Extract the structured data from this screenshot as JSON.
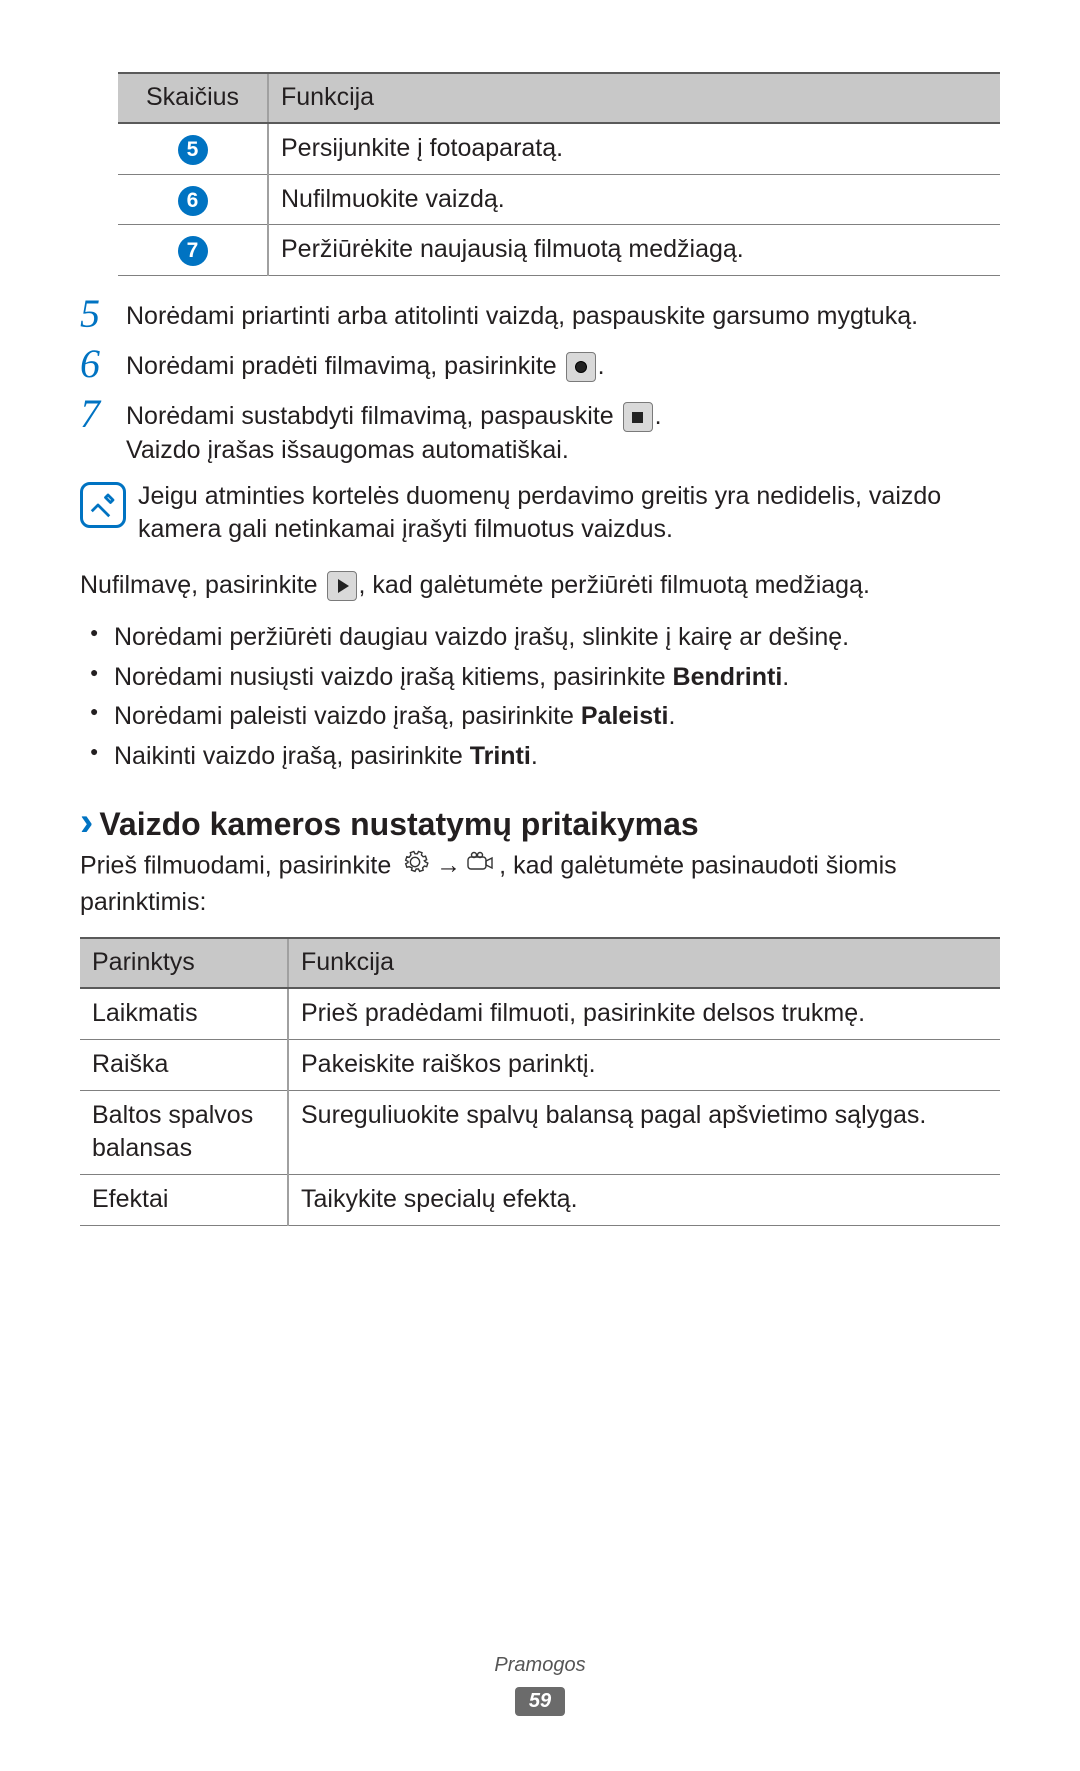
{
  "table1": {
    "headers": [
      "Skaičius",
      "Funkcija"
    ],
    "rows": [
      {
        "num": "5",
        "func": "Persijunkite į fotoaparatą."
      },
      {
        "num": "6",
        "func": "Nufilmuokite vaizdą."
      },
      {
        "num": "7",
        "func": "Peržiūrėkite naujausią filmuotą medžiagą."
      }
    ]
  },
  "steps": {
    "s5": {
      "num": "5",
      "text": "Norėdami priartinti arba atitolinti vaizdą, paspauskite garsumo mygtuką."
    },
    "s6": {
      "num": "6",
      "text_before": "Norėdami pradėti filmavimą, pasirinkite ",
      "text_after": "."
    },
    "s7": {
      "num": "7",
      "line1_before": "Norėdami sustabdyti filmavimą, paspauskite ",
      "line1_after": ".",
      "line2": "Vaizdo įrašas išsaugomas automatiškai."
    }
  },
  "note": "Jeigu atminties kortelės duomenų perdavimo greitis yra nedidelis, vaizdo kamera gali netinkamai įrašyti filmuotus vaizdus.",
  "after_note": {
    "before": "Nufilmavę, pasirinkite ",
    "after": ", kad galėtumėte peržiūrėti filmuotą medžiagą."
  },
  "bullets": [
    {
      "text": "Norėdami peržiūrėti daugiau vaizdo įrašų, slinkite į kairę ar dešinę."
    },
    {
      "pre": "Norėdami nusiųsti vaizdo įrašą kitiems, pasirinkite ",
      "bold": "Bendrinti",
      "post": "."
    },
    {
      "pre": "Norėdami paleisti vaizdo įrašą, pasirinkite ",
      "bold": "Paleisti",
      "post": "."
    },
    {
      "pre": "Naikinti vaizdo įrašą, pasirinkite ",
      "bold": "Trinti",
      "post": "."
    }
  ],
  "section": {
    "title": "Vaizdo kameros nustatymų pritaikymas",
    "intro_before": "Prieš filmuodami, pasirinkite ",
    "intro_after": ", kad galėtumėte pasinaudoti šiomis parinktimis:",
    "arrow": "→"
  },
  "table2": {
    "headers": [
      "Parinktys",
      "Funkcija"
    ],
    "rows": [
      {
        "opt": "Laikmatis",
        "func": "Prieš pradėdami filmuoti, pasirinkite delsos trukmę."
      },
      {
        "opt": "Raiška",
        "func": "Pakeiskite raiškos parinktį."
      },
      {
        "opt": "Baltos spalvos balansas",
        "func": "Sureguliuokite spalvų balansą pagal apšvietimo sąlygas."
      },
      {
        "opt": "Efektai",
        "func": "Taikykite specialų efektą."
      }
    ]
  },
  "footer": {
    "section": "Pramogos",
    "page": "59"
  }
}
